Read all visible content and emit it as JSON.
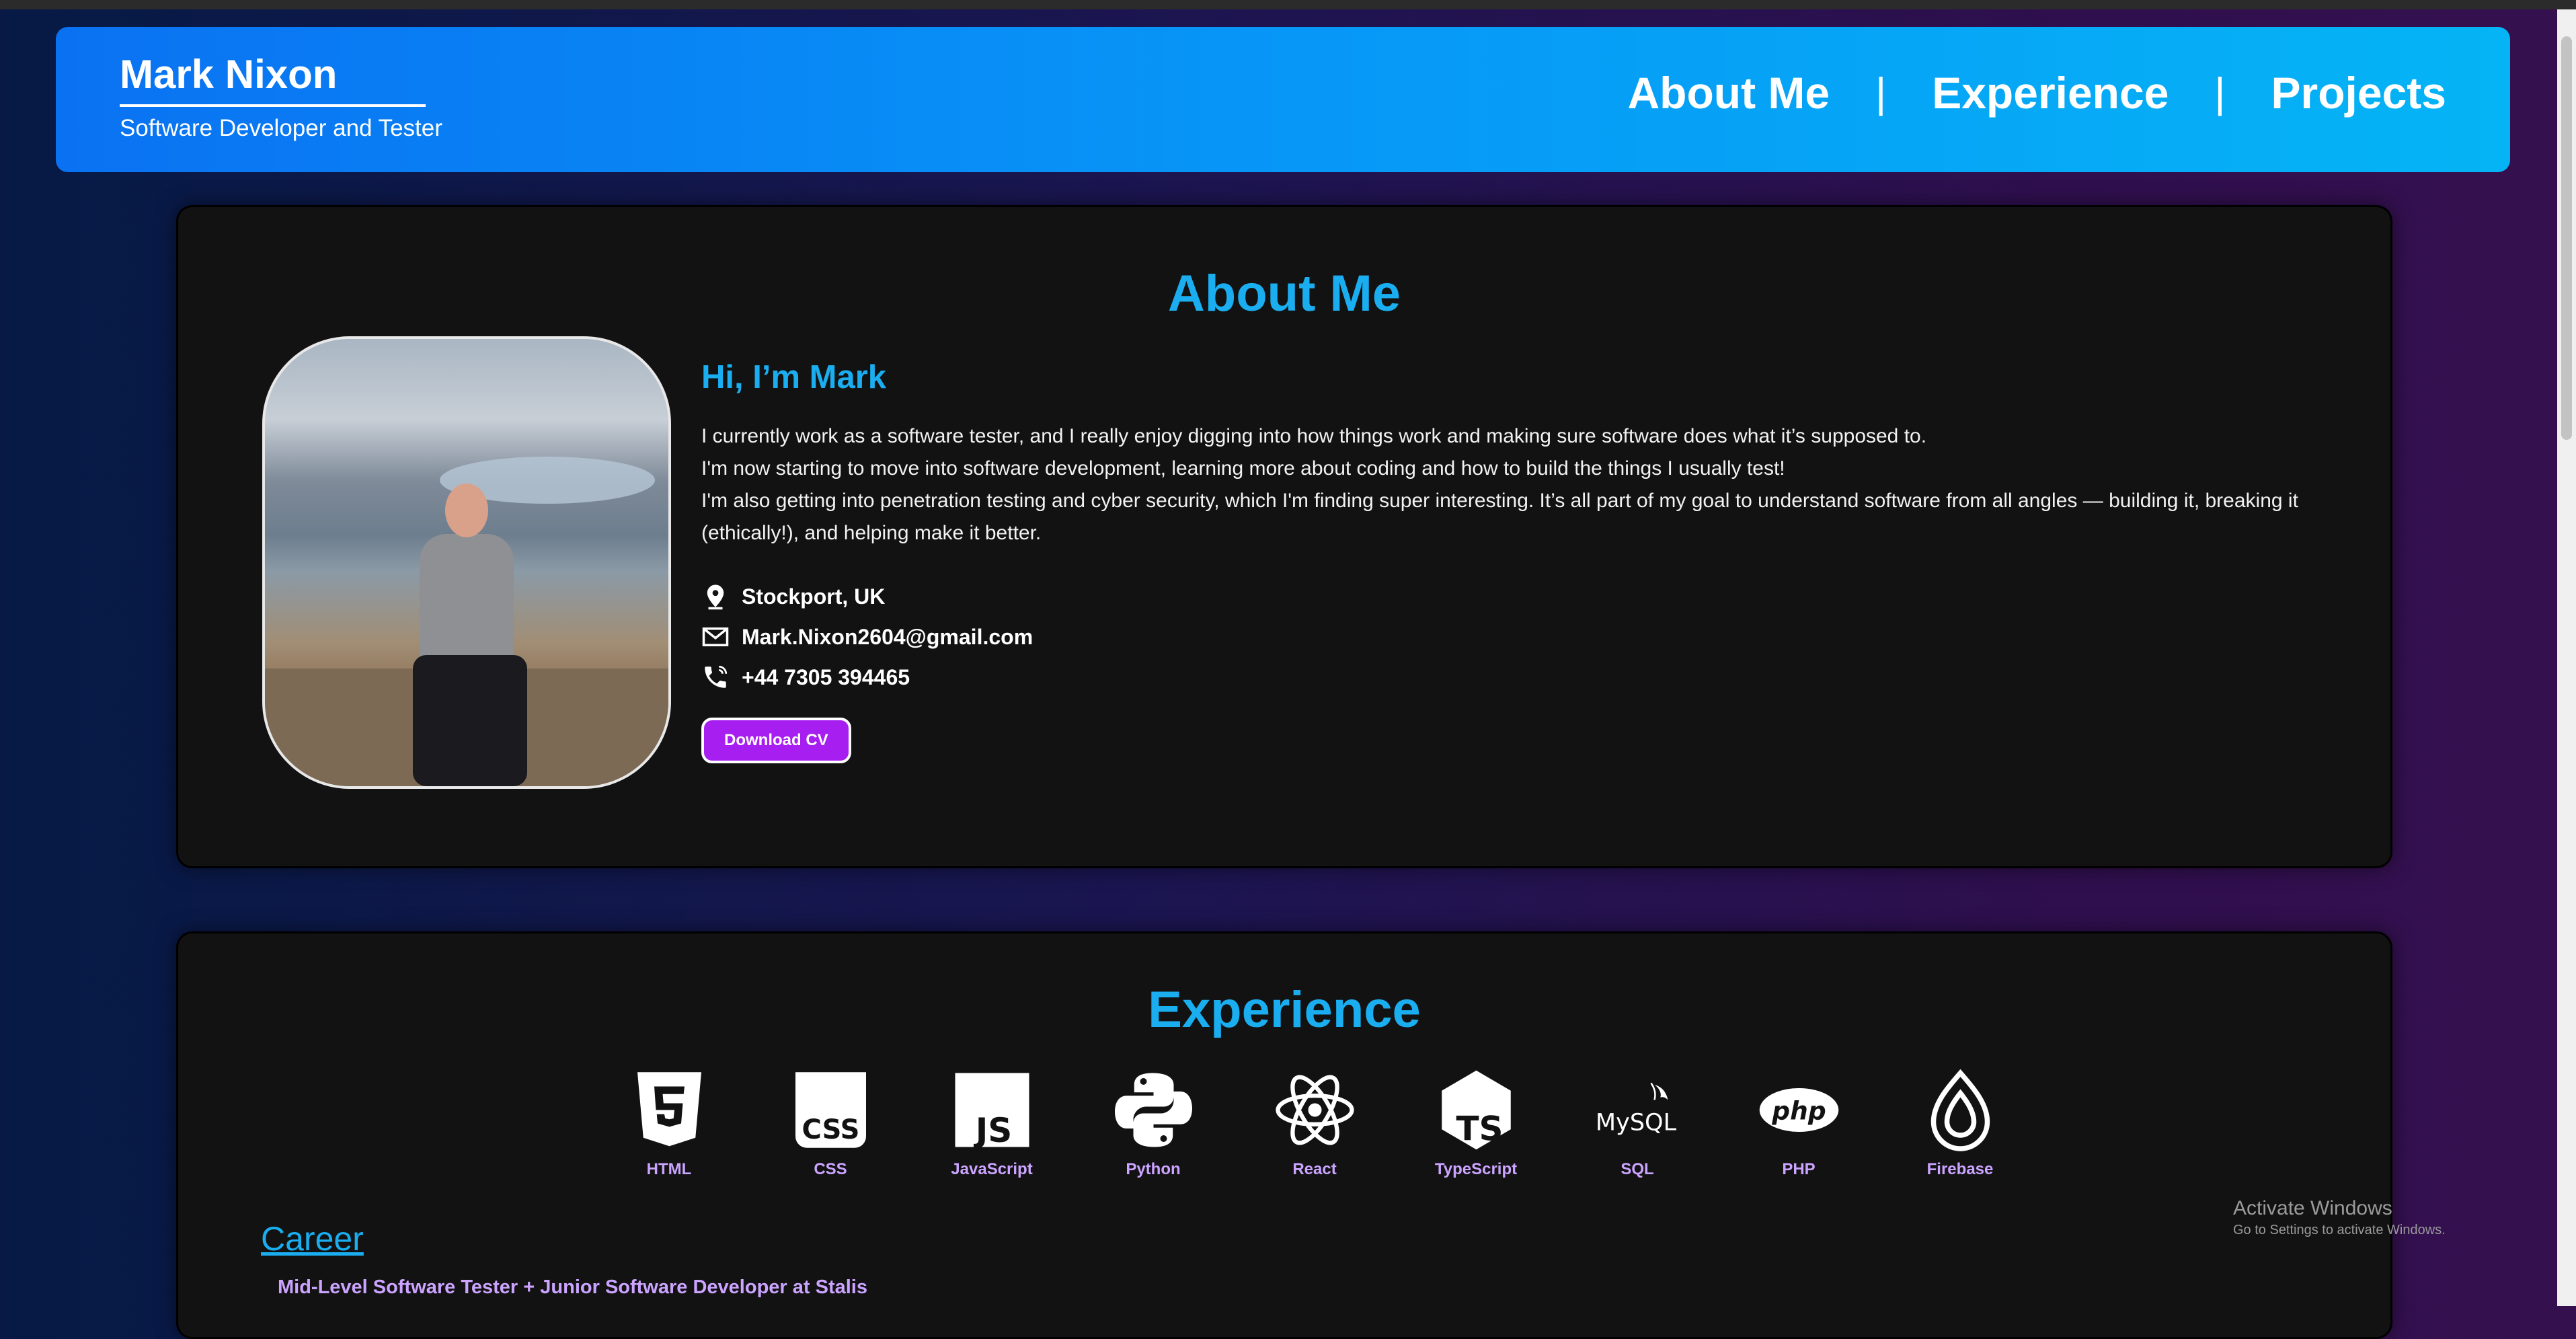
{
  "header": {
    "name": "Mark Nixon",
    "tagline": "Software Developer and Tester",
    "nav": [
      {
        "label": "About Me"
      },
      {
        "label": "Experience"
      },
      {
        "label": "Projects"
      }
    ],
    "separator": "|"
  },
  "about": {
    "title": "About Me",
    "greeting": "Hi, I’m Mark",
    "paragraphs": [
      "I currently work as a software tester, and I really enjoy digging into how things work and making sure software does what it’s supposed to.",
      "I'm now starting to move into software development, learning more about coding and how to build the things I usually test!",
      "I'm also getting into penetration testing and cyber security, which I'm finding super interesting. It’s all part of my goal to understand software from all angles — building it, breaking it (ethically!), and helping make it better."
    ],
    "location": "Stockport, UK",
    "email": "Mark.Nixon2604@gmail.com",
    "phone": "+44 7305 394465",
    "cv_button": "Download CV"
  },
  "experience": {
    "title": "Experience",
    "skills": [
      {
        "label": "HTML",
        "icon": "html5-icon"
      },
      {
        "label": "CSS",
        "icon": "css-icon"
      },
      {
        "label": "JavaScript",
        "icon": "javascript-icon"
      },
      {
        "label": "Python",
        "icon": "python-icon"
      },
      {
        "label": "React",
        "icon": "react-icon"
      },
      {
        "label": "TypeScript",
        "icon": "typescript-icon"
      },
      {
        "label": "SQL",
        "icon": "mysql-icon"
      },
      {
        "label": "PHP",
        "icon": "php-icon"
      },
      {
        "label": "Firebase",
        "icon": "firebase-icon"
      }
    ],
    "career_heading": "Career",
    "role": "Mid-Level Software Tester + Junior Software Developer at Stalis",
    "icon_text": {
      "css": "CSS",
      "js": "JS",
      "ts": "TS",
      "mysql": "MySQL",
      "php": "php"
    }
  },
  "os_watermark": {
    "line1": "Activate Windows",
    "line2": "Go to Settings to activate Windows."
  },
  "colors": {
    "accent": "#1aaef0",
    "header_start": "#0a72f2",
    "header_end": "#05b4f5",
    "button": "#a61ff0",
    "skill_label": "#cba4ff",
    "card": "#121212"
  }
}
